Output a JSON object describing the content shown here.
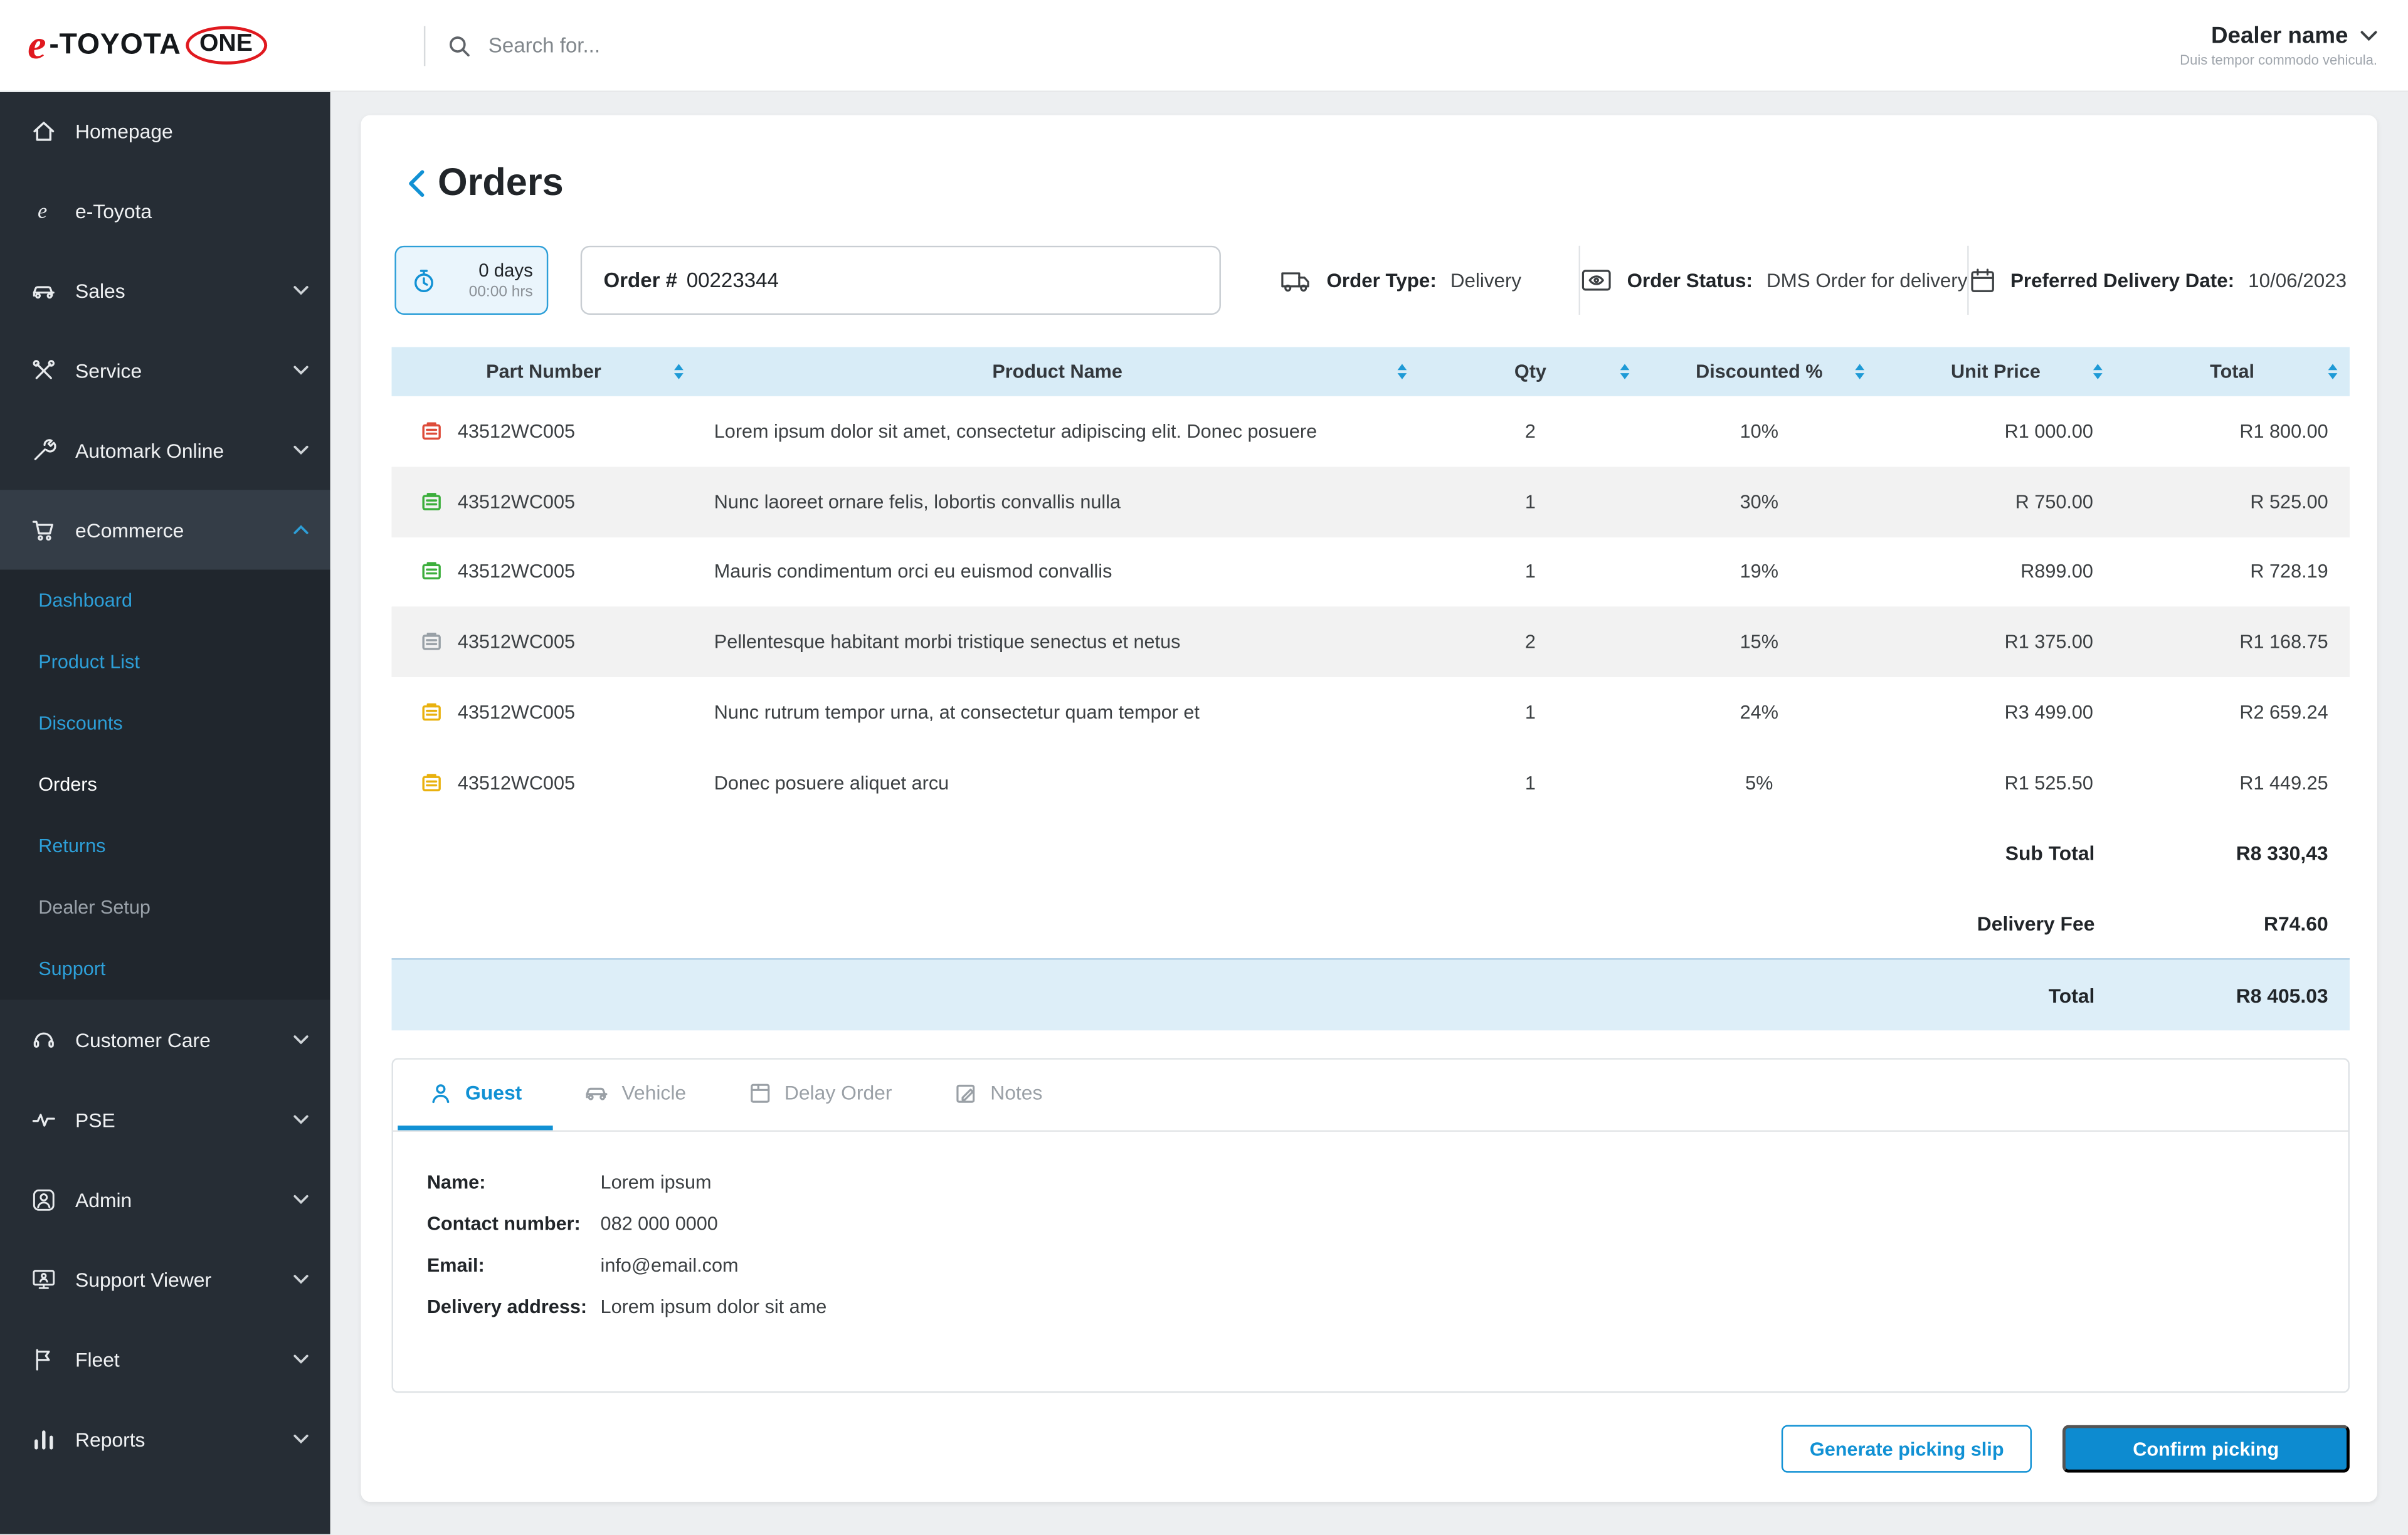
{
  "header": {
    "logo": {
      "e": "e",
      "brand": "-TOYOTA",
      "badge": "ONE"
    },
    "search_placeholder": "Search for...",
    "dealer_name": "Dealer name",
    "dealer_subtitle": "Duis tempor commodo vehicula."
  },
  "sidebar": {
    "main": [
      {
        "label": "Homepage"
      },
      {
        "label": "e-Toyota"
      },
      {
        "label": "Sales"
      },
      {
        "label": "Service"
      },
      {
        "label": "Automark Online"
      },
      {
        "label": "eCommerce"
      }
    ],
    "ecommerce_sub": [
      {
        "label": "Dashboard"
      },
      {
        "label": "Product List"
      },
      {
        "label": "Discounts"
      },
      {
        "label": "Orders"
      },
      {
        "label": "Returns"
      },
      {
        "label": "Dealer Setup"
      },
      {
        "label": "Support"
      }
    ],
    "bottom": [
      {
        "label": "Customer Care"
      },
      {
        "label": "PSE"
      },
      {
        "label": "Admin"
      },
      {
        "label": "Support Viewer"
      },
      {
        "label": "Fleet"
      },
      {
        "label": "Reports"
      }
    ]
  },
  "page": {
    "title": "Orders",
    "timer_days": "0 days",
    "timer_hours": "00:00 hrs",
    "order_label": "Order #",
    "order_number": "00223344",
    "order_type_label": "Order Type:",
    "order_type_value": "Delivery",
    "order_status_label": "Order Status:",
    "order_status_value": "DMS Order for delivery",
    "delivery_date_label": "Preferred Delivery Date:",
    "delivery_date_value": "10/06/2023"
  },
  "table": {
    "columns": [
      "Part Number",
      "Product Name",
      "Qty",
      "Discounted %",
      "Unit Price",
      "Total"
    ],
    "rows": [
      {
        "icon": "red",
        "part": "43512WC005",
        "name": "Lorem ipsum dolor sit amet, consectetur adipiscing elit. Donec posuere",
        "qty": "2",
        "discount": "10%",
        "unit_price": "R1 000.00",
        "total": "R1 800.00"
      },
      {
        "icon": "green",
        "part": "43512WC005",
        "name": "Nunc laoreet ornare felis, lobortis convallis nulla",
        "qty": "1",
        "discount": "30%",
        "unit_price": "R 750.00",
        "total": "R 525.00"
      },
      {
        "icon": "green",
        "part": "43512WC005",
        "name": "Mauris condimentum orci eu euismod convallis",
        "qty": "1",
        "discount": "19%",
        "unit_price": "R899.00",
        "total": "R 728.19"
      },
      {
        "icon": "gray",
        "part": "43512WC005",
        "name": "Pellentesque habitant morbi tristique senectus et netus",
        "qty": "2",
        "discount": "15%",
        "unit_price": "R1 375.00",
        "total": "R1 168.75"
      },
      {
        "icon": "yellow",
        "part": "43512WC005",
        "name": "Nunc rutrum tempor urna, at consectetur quam tempor et",
        "qty": "1",
        "discount": "24%",
        "unit_price": "R3 499.00",
        "total": "R2 659.24"
      },
      {
        "icon": "yellow",
        "part": "43512WC005",
        "name": "Donec posuere aliquet arcu",
        "qty": "1",
        "discount": "5%",
        "unit_price": "R1 525.50",
        "total": "R1 449.25"
      }
    ],
    "subtotal_label": "Sub Total",
    "subtotal_value": "R8 330,43",
    "delivery_fee_label": "Delivery Fee",
    "delivery_fee_value": "R74.60",
    "total_label": "Total",
    "total_value": "R8 405.03"
  },
  "tabs": [
    {
      "label": "Guest"
    },
    {
      "label": "Vehicle"
    },
    {
      "label": "Delay Order"
    },
    {
      "label": "Notes"
    }
  ],
  "guest": [
    {
      "label": "Name:",
      "value": "Lorem ipsum"
    },
    {
      "label": "Contact number:",
      "value": "082 000 0000"
    },
    {
      "label": "Email:",
      "value": "info@email.com"
    },
    {
      "label": "Delivery address:",
      "value": "Lorem ipsum dolor sit ame"
    }
  ],
  "actions": {
    "generate_picking_slip": "Generate picking slip",
    "confirm_picking": "Confirm picking"
  },
  "colors": {
    "accent_blue": "#0d8bd0",
    "brand_red": "#e0191f",
    "sidebar_bg": "#262d35",
    "table_header_bg": "#d8ecf7",
    "total_row_bg": "#ddeef8",
    "status_red": "#dd4b39",
    "status_green": "#3cae3c",
    "status_gray": "#98a0a6",
    "status_yellow": "#e9b10e"
  }
}
